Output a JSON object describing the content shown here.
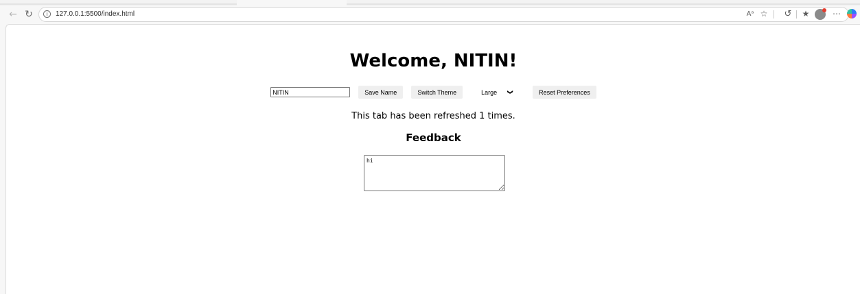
{
  "browser": {
    "url": "127.0.0.1:5500/index.html",
    "readaloud_label": "Aᵃ"
  },
  "page": {
    "heading": "Welcome, NITIN!",
    "name_input_value": "NITIN",
    "save_name_label": "Save Name",
    "switch_theme_label": "Switch Theme",
    "font_size_selected": "Large",
    "reset_label": "Reset Preferences",
    "refresh_text": "This tab has been refreshed 1 times.",
    "feedback_heading": "Feedback",
    "feedback_value": "hi"
  }
}
